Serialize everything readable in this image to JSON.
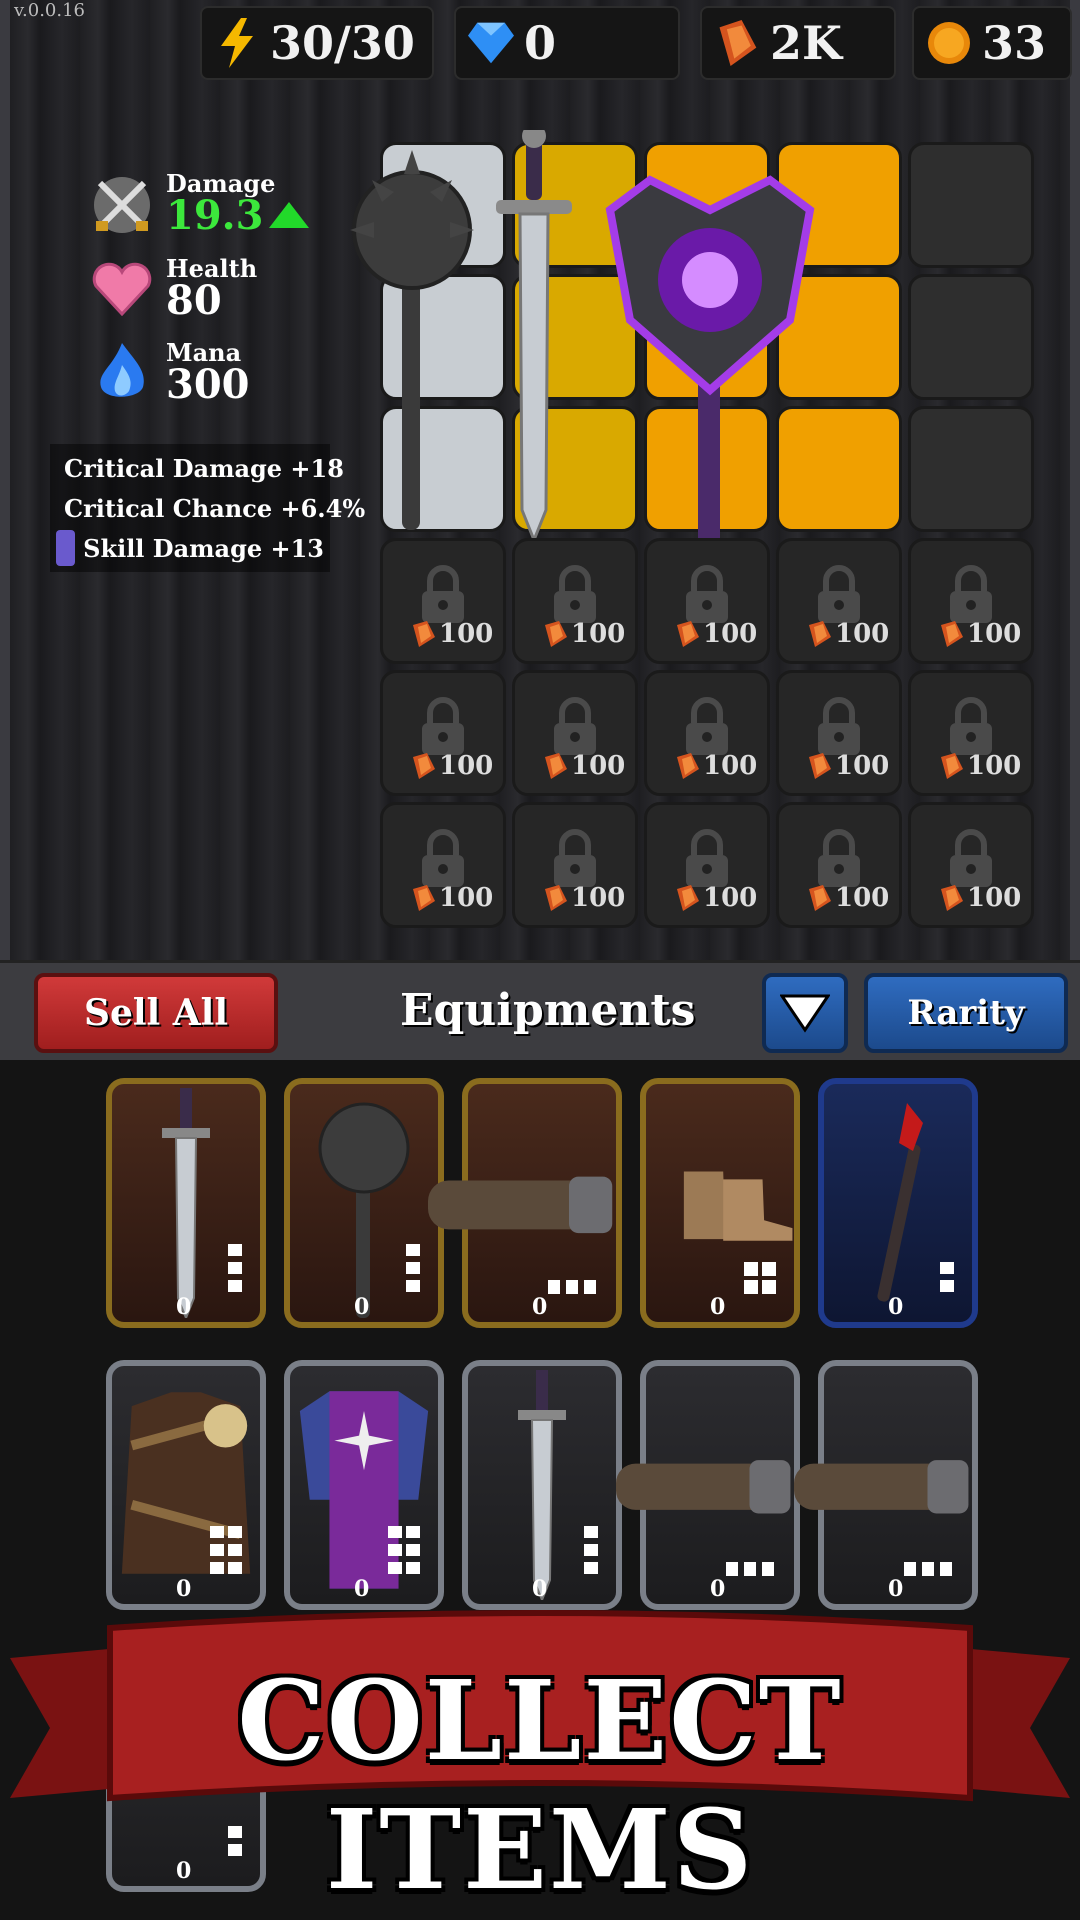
{
  "version": "v.0.0.16",
  "resources": {
    "energy": "30/30",
    "gems": "0",
    "crystals": "2K",
    "coins": "33"
  },
  "stats": {
    "damage_label": "Damage",
    "damage_value": "19.3",
    "health_label": "Health",
    "health_value": "80",
    "mana_label": "Mana",
    "mana_value": "300"
  },
  "bonuses": [
    {
      "label": "Critical Damage +18"
    },
    {
      "label": "Critical Chance +6.4%"
    },
    {
      "label": "Skill Damage +13"
    }
  ],
  "grid": {
    "unlock_cost": "100"
  },
  "toolbar": {
    "sell_all": "Sell All",
    "title": "Equipments",
    "sort": "Rarity"
  },
  "inventory": {
    "counts": [
      "0",
      "0",
      "0",
      "0",
      "0",
      "0",
      "0",
      "0",
      "0",
      "0",
      "0"
    ]
  },
  "banner": {
    "text": "COLLECT ITEMS"
  },
  "colors": {
    "green_stat": "#3ce83c",
    "sell_red": "#c02a2a",
    "button_blue": "#2558a4",
    "legendary_orange": "#f0a000",
    "rare_yellow": "#d9a900"
  }
}
